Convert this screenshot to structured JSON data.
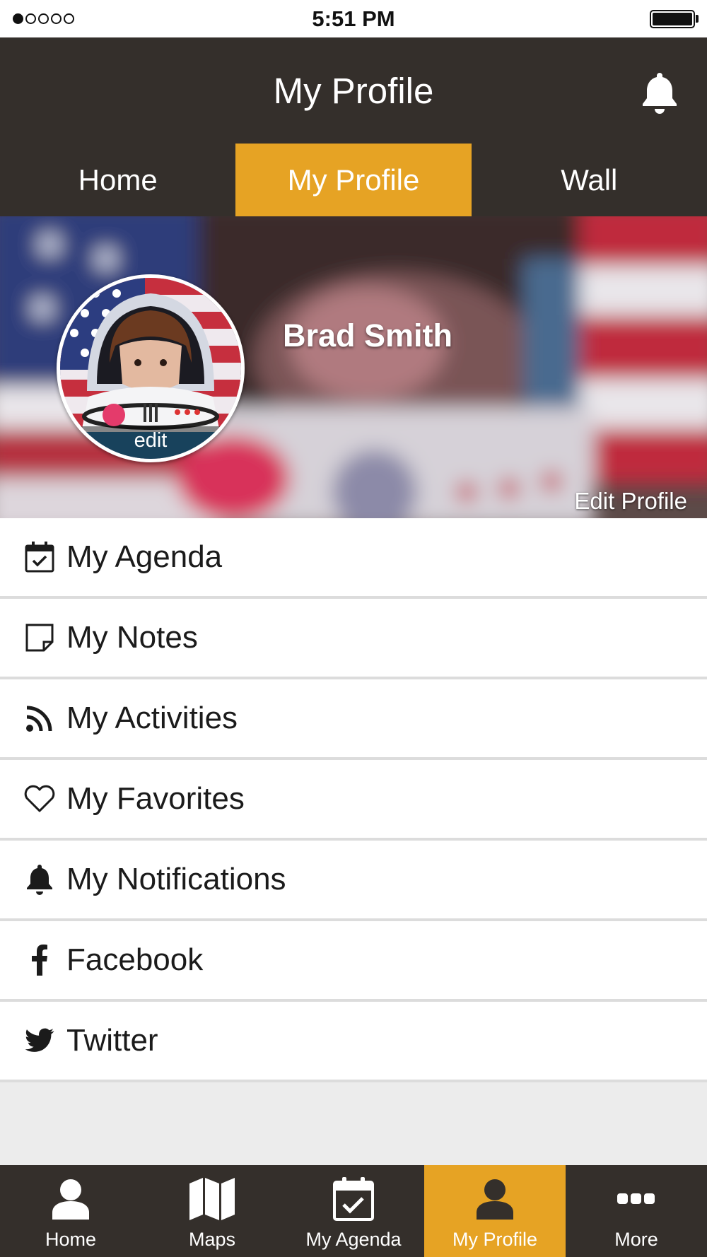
{
  "status_bar": {
    "time": "5:51 PM"
  },
  "header": {
    "title": "My Profile",
    "notification_icon": "bell-icon"
  },
  "top_tabs": [
    {
      "label": "Home",
      "active": false
    },
    {
      "label": "My Profile",
      "active": true
    },
    {
      "label": "Wall",
      "active": false
    }
  ],
  "profile": {
    "name": "Brad Smith",
    "avatar_edit_label": "edit",
    "edit_profile_label": "Edit Profile"
  },
  "menu": [
    {
      "label": "My Agenda",
      "icon": "calendar-check-icon"
    },
    {
      "label": "My Notes",
      "icon": "note-icon"
    },
    {
      "label": "My Activities",
      "icon": "rss-icon"
    },
    {
      "label": "My Favorites",
      "icon": "heart-icon"
    },
    {
      "label": "My Notifications",
      "icon": "bell-icon"
    },
    {
      "label": "Facebook",
      "icon": "facebook-icon"
    },
    {
      "label": "Twitter",
      "icon": "twitter-icon"
    }
  ],
  "bottom_nav": [
    {
      "label": "Home",
      "icon": "person-icon",
      "active": false
    },
    {
      "label": "Maps",
      "icon": "map-icon",
      "active": false
    },
    {
      "label": "My Agenda",
      "icon": "calendar-check-icon",
      "active": false
    },
    {
      "label": "My Profile",
      "icon": "person-icon",
      "active": true
    },
    {
      "label": "More",
      "icon": "more-dots-icon",
      "active": false
    }
  ],
  "colors": {
    "header_bg": "#342f2b",
    "accent": "#e6a324",
    "list_bg": "#ffffff",
    "page_bg": "#ececec"
  }
}
